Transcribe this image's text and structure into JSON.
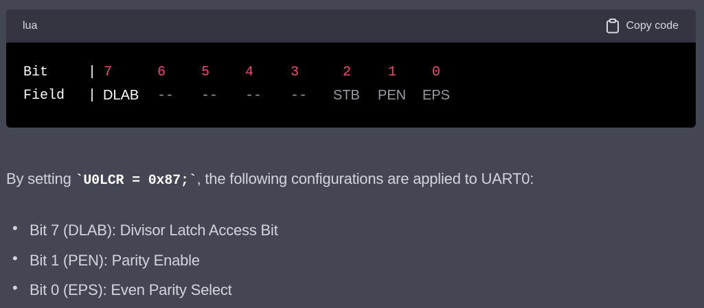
{
  "code_block": {
    "language": "lua",
    "copy_label": "Copy code",
    "rows": [
      {
        "label": "Bit",
        "separator": "|",
        "cells": [
          "7",
          "6",
          "5",
          "4",
          "3",
          "2",
          "1",
          "0"
        ]
      },
      {
        "label": "Field",
        "separator": "|",
        "cells": [
          "DLAB",
          "--",
          "--",
          "--",
          "--",
          "STB",
          "PEN",
          "EPS"
        ]
      }
    ]
  },
  "prose": {
    "before": "By setting ",
    "code": "`U0LCR = 0x87;`",
    "after": ", the following configurations are applied to UART0:"
  },
  "bullets": [
    "Bit 7 (DLAB): Divisor Latch Access Bit",
    "Bit 1 (PEN): Parity Enable",
    "Bit 0 (EPS): Even Parity Select"
  ],
  "colors": {
    "page_bg": "#444654",
    "code_header_bg": "#343541",
    "code_bg": "#000000",
    "number_accent": "#ef4b73",
    "prose_text": "#d1d5db"
  },
  "icons": {
    "copy": "clipboard-icon"
  }
}
